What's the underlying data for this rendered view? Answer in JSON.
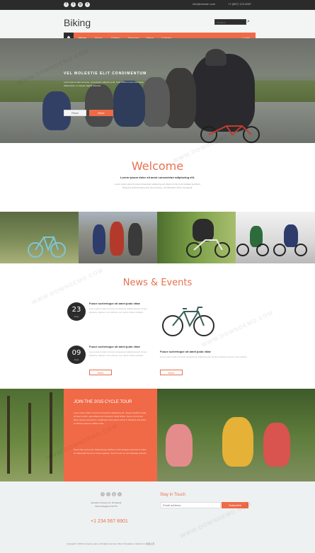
{
  "topbar": {
    "social_icons": [
      "facebook-icon",
      "twitter-icon",
      "google-plus-icon",
      "rss-icon"
    ],
    "email": "info@domain.com",
    "phone": "+1 (887) 123-4567"
  },
  "header": {
    "logo": "Biking",
    "search_placeholder": "Search"
  },
  "nav": {
    "items": [
      "Home",
      "About",
      "Gallery",
      "Services",
      "News",
      "Contact",
      "Login"
    ],
    "active": "Home",
    "accent": "#f06a47"
  },
  "hero": {
    "headline": "VEL MOLESTIE ELIT CONDIMENTUM",
    "text": "Lorem ipsum dolor sit amet, consectetur adipiscing elit. Cras efficitur lectus sed ligula ullamcorper, in congue magna pharetra.",
    "button_primary": "Read",
    "button_secondary": "More"
  },
  "welcome": {
    "title": "Welcome",
    "subtitle": "Lorem ipsum dolor sit amet consectetur adipiscing elit.",
    "text": "Lorem ipsum dolor sit amet consectetur adipiscing elit. Etiam id nisi in dui sodales hendrerit. Praesent euismod lacus quis sem posuere, vel bibendum tortor consequat."
  },
  "news": {
    "title": "News & Events",
    "events": [
      {
        "day": "23",
        "month": "June",
        "title": "Fusce scelerisque sit amet justo vitae",
        "text": "Lorem ipsum dolor sit amet consectetur adipiscing elit. Donec pharetra massa in orci ultrices, nec varius metus volutpat."
      },
      {
        "day": "09",
        "month": "June",
        "title": "Fusce scelerisque sit amet justo vitae",
        "text": "Lorem ipsum dolor sit amet consectetur adipiscing elit. Donec pharetra massa in orci ultrices, nec varius metus volutpat.",
        "button": "More"
      },
      {
        "title": "Fusce scelerisque sit amet justo vitae",
        "text": "Lorem ipsum dolor sit amet consectetur adipiscing elit. Donec pharetra massa in orci ultrices.",
        "button": "More"
      }
    ]
  },
  "tour": {
    "title": "JOIN THE 2015 CYCLE TOUR",
    "paragraphs": [
      "Lorem ipsum dolor sit amet consectetur adipiscing elit. Integer faucibus turpis at risus tempor, eget aliquet arcu tincidunt. Nulla facilisi. Donec ut nisl sed libero lacinia elementum. Vestibulum ante ipsum primis in faucibus orci luctus et ultrices posuere cubilia curae.",
      "Nunc vitae porta velit. Pellentesque habitant morbi tristique senectus et netus et malesuada fames ac turpis egestas. Sed vel arcu eu nisl vulputate posuere."
    ]
  },
  "footer": {
    "social_icons": [
      "facebook-icon",
      "twitter-icon",
      "google-plus-icon",
      "rss-icon"
    ],
    "address": "Excellent Temple Inc. 26 Adama Plaza Singapore 94779",
    "phone": "+1 234 567 8901",
    "newsletter_title": "Stay in Touch",
    "newsletter_placeholder": "Email address",
    "newsletter_button": "Subscribe",
    "copyright": "Copyright © 2015 Company name. All rights reserved. More Templates. Collect from 模板之家"
  },
  "watermark": "WWW.DOWNDEMO.COM"
}
